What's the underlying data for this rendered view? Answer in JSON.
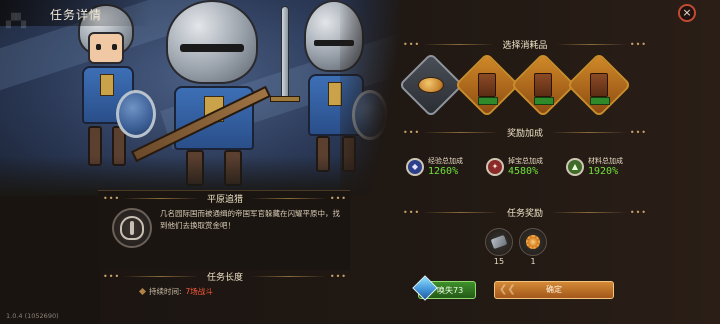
{
  "header": {
    "title": "任务详情",
    "close_label": "×"
  },
  "mission": {
    "name": "平原追猎",
    "description": "几名园际国而被通缉的帝国军官躲藏在闪耀平原中，找到他们去换取赏金吧！",
    "duration_section": "任务长度",
    "duration_label": "持续时间:",
    "duration_value": "7场战斗"
  },
  "consumables": {
    "section": "选择消耗品",
    "items": [
      {
        "icon": "bread-icon",
        "badge": ""
      },
      {
        "icon": "book-icon",
        "badge": ""
      },
      {
        "icon": "book-icon",
        "badge": ""
      },
      {
        "icon": "book-icon",
        "badge": ""
      }
    ]
  },
  "bonuses": {
    "section": "奖励加成",
    "items": [
      {
        "icon": "shield-icon",
        "label": "经验总加成",
        "value": "1260%",
        "color": "#6fe03a"
      },
      {
        "icon": "treasure-icon",
        "label": "掉宝总加成",
        "value": "4580%",
        "color": "#6fe03a"
      },
      {
        "icon": "material-icon",
        "label": "材料总加成",
        "value": "1920%",
        "color": "#6fe03a"
      }
    ]
  },
  "rewards": {
    "section": "任务奖励",
    "items": [
      {
        "icon": "stone-icon",
        "count": "15"
      },
      {
        "icon": "gear-icon",
        "count": "1"
      }
    ]
  },
  "buttons": {
    "quick_label": "唤失73",
    "confirm_label": "确定"
  },
  "footer": {
    "version": "1.0.4 (1052690)"
  },
  "colors": {
    "accent_orange": "#d38a36",
    "accent_green": "#6fe03a",
    "danger": "#c24a33"
  }
}
